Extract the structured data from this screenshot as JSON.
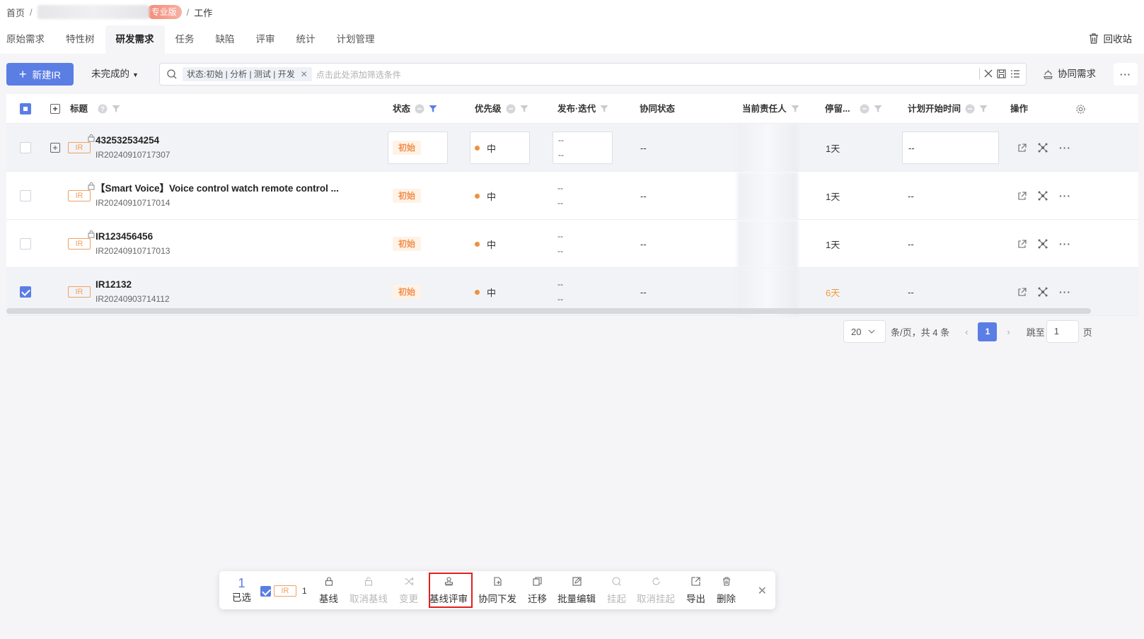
{
  "breadcrumb": {
    "home": "首页",
    "badge": "专业版",
    "current": "工作"
  },
  "tabs": [
    "原始需求",
    "特性树",
    "研发需求",
    "任务",
    "缺陷",
    "评审",
    "统计",
    "计划管理"
  ],
  "recycle_label": "回收站",
  "toolbar": {
    "new_label": "新建IR",
    "filter_dropdown": "未完成的",
    "chip": "状态:初始 | 分析 | 测试 | 开发",
    "filter_placeholder": "点击此处添加筛选条件",
    "collab_label": "协同需求"
  },
  "columns": {
    "title": "标题",
    "status": "状态",
    "priority": "优先级",
    "release": "发布·迭代",
    "collab_state": "协同状态",
    "assignee": "当前责任人",
    "stay": "停留...",
    "plan_start": "计划开始时间",
    "ops": "操作"
  },
  "rows": [
    {
      "type": "IR",
      "title": "432532534254",
      "id": "IR20240910717307",
      "status": "初始",
      "priority": "中",
      "release_a": "--",
      "release_b": "--",
      "collab": "--",
      "stay": "1天",
      "plan": "--",
      "checked": false
    },
    {
      "type": "IR",
      "title": "【Smart Voice】Voice control watch remote control ...",
      "id": "IR20240910717014",
      "status": "初始",
      "priority": "中",
      "release_a": "--",
      "release_b": "--",
      "collab": "--",
      "stay": "1天",
      "plan": "--",
      "checked": false
    },
    {
      "type": "IR",
      "title": "IR123456456",
      "id": "IR20240910717013",
      "status": "初始",
      "priority": "中",
      "release_a": "--",
      "release_b": "--",
      "collab": "--",
      "stay": "1天",
      "plan": "--",
      "checked": false
    },
    {
      "type": "IR",
      "title": "IR12132",
      "id": "IR20240903714112",
      "status": "初始",
      "priority": "中",
      "release_a": "--",
      "release_b": "--",
      "collab": "--",
      "stay": "6天",
      "plan": "--",
      "checked": true
    }
  ],
  "pagination": {
    "page_size": "20",
    "total_text": "条/页，共 4 条",
    "current": "1",
    "jump_label": "跳至",
    "jump_value": "1",
    "page_label": "页"
  },
  "batch": {
    "count": "1",
    "selected_label": "已选",
    "type_tag": "IR",
    "type_count": "1",
    "actions": [
      "基线",
      "取消基线",
      "变更",
      "基线评审",
      "协同下发",
      "迁移",
      "批量编辑",
      "挂起",
      "取消挂起",
      "导出",
      "删除"
    ]
  },
  "colors": {
    "accent": "#5b7ee5",
    "status": "#f09050",
    "warn": "#f39a3c",
    "highlight": "#e02020"
  }
}
